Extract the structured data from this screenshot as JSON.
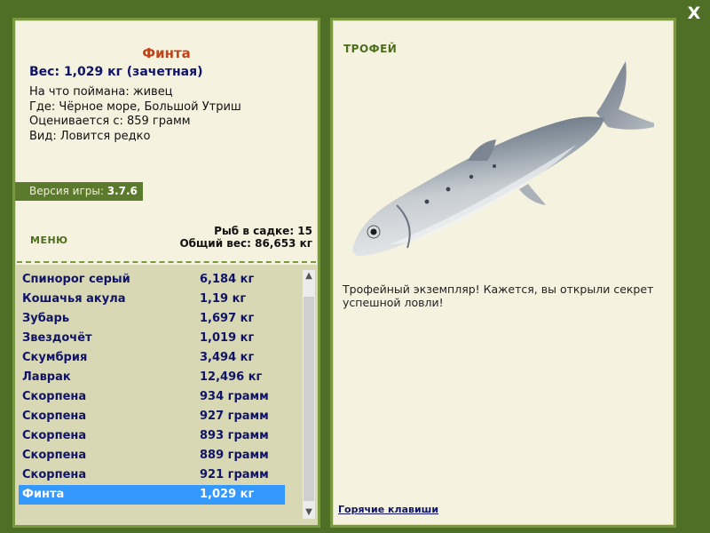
{
  "window": {
    "close_label": "X"
  },
  "fish_info": {
    "name": "Финта",
    "weight_line": "Вес: 1,029 кг (зачетная)",
    "lines": [
      "На что поймана: живец",
      "Где: Чёрное море, Большой Утриш",
      "Оценивается с: 859 грамм",
      "Вид: Ловится редко"
    ]
  },
  "version": {
    "label": "Версия игры:",
    "value": "3.7.6"
  },
  "menu": {
    "label": "МЕНЮ"
  },
  "catch_stats": {
    "fish_count": "Рыб в садке: 15",
    "total_weight": "Общий вес: 86,653 кг"
  },
  "catch_list": [
    {
      "name": "Спинорог серый",
      "weight": "6,184 кг"
    },
    {
      "name": "Кошачья акула",
      "weight": "1,19 кг"
    },
    {
      "name": "Зубарь",
      "weight": "1,697 кг"
    },
    {
      "name": "Звездочёт",
      "weight": "1,019 кг"
    },
    {
      "name": "Скумбрия",
      "weight": "3,494 кг"
    },
    {
      "name": "Лаврак",
      "weight": "12,496 кг"
    },
    {
      "name": "Скорпена",
      "weight": "934 грамм"
    },
    {
      "name": "Скорпена",
      "weight": "927 грамм"
    },
    {
      "name": "Скорпена",
      "weight": "893 грамм"
    },
    {
      "name": "Скорпена",
      "weight": "889 грамм"
    },
    {
      "name": "Скорпена",
      "weight": "921 грамм"
    },
    {
      "name": "Финта",
      "weight": "1,029 кг",
      "selected": true
    }
  ],
  "trophy": {
    "title": "ТРОФЕЙ",
    "description": "Трофейный экземпляр! Кажется, вы открыли секрет успешной ловли!"
  },
  "hotkeys": {
    "label": "Горячие клавиши"
  },
  "colors": {
    "background": "#4f6f26",
    "panel": "#f5f2df",
    "panel_border": "#7a9840",
    "list_background": "#d8d8b4",
    "selection": "#3399ff",
    "fish_name": "#c0441a",
    "navy_text": "#101468",
    "olive_heading": "#4b6d1c"
  },
  "icons": {
    "close": "close-icon",
    "scroll_up": "chevron-up-icon",
    "scroll_down": "chevron-down-icon"
  }
}
